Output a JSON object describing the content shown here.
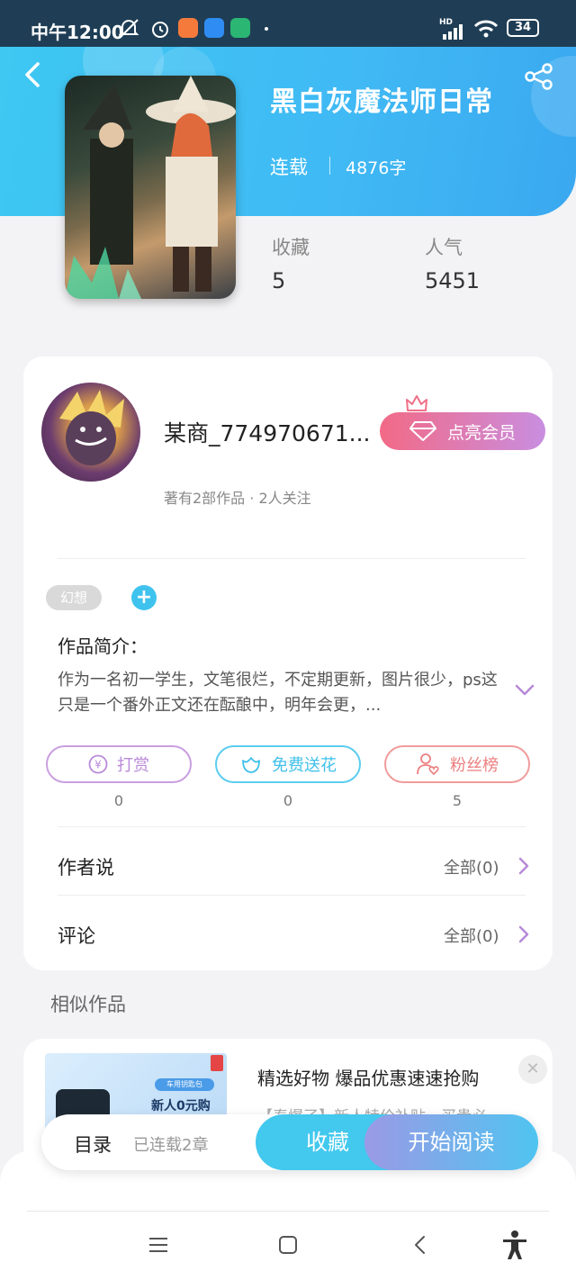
{
  "status_bar": {
    "time": "中午12:00",
    "battery": "34",
    "signal_label": "HD"
  },
  "header": {
    "title": "黑白灰魔法师日常",
    "status": "连载",
    "word_count": "4876字",
    "stats": [
      {
        "label": "收藏",
        "value": "5"
      },
      {
        "label": "人气",
        "value": "5451"
      }
    ]
  },
  "author": {
    "name": "某商_774970671...",
    "vip_button": "点亮会员",
    "meta": "著有2部作品 · 2人关注"
  },
  "tags": [
    "幻想"
  ],
  "intro": {
    "title": "作品简介：",
    "text": "作为一名初一学生，文笔很烂，不定期更新，图片很少，ps这只是一个番外正文还在酝酿中，明年会更，..."
  },
  "actions": [
    {
      "label": "打赏",
      "count": "0",
      "color": "#b98ad9",
      "icon": "yen-icon"
    },
    {
      "label": "免费送花",
      "count": "0",
      "color": "#45c6ec",
      "icon": "flower-icon"
    },
    {
      "label": "粉丝榜",
      "count": "5",
      "color": "#ef8c8c",
      "icon": "fan-icon"
    }
  ],
  "rows": [
    {
      "label": "作者说",
      "right": "全部(0)"
    },
    {
      "label": "评论",
      "right": "全部(0)"
    }
  ],
  "similar": {
    "title": "相似作品",
    "ad_title": "精选好物 爆品优惠速速抢购",
    "ad_sub": "【泰爆了】新人特价补贴，买贵必",
    "ad_image_text": "新人0元购",
    "ad_image_badge": "车用钥匙包"
  },
  "bottom_bar": {
    "toc": "目录",
    "toc_sub": "已连载2章",
    "favorite": "收藏",
    "start_reading": "开始阅读"
  },
  "colors": {
    "accent": "#3fc3ee",
    "vip_gradient_start": "#f26a86",
    "vip_gradient_end": "#c98ee0"
  }
}
